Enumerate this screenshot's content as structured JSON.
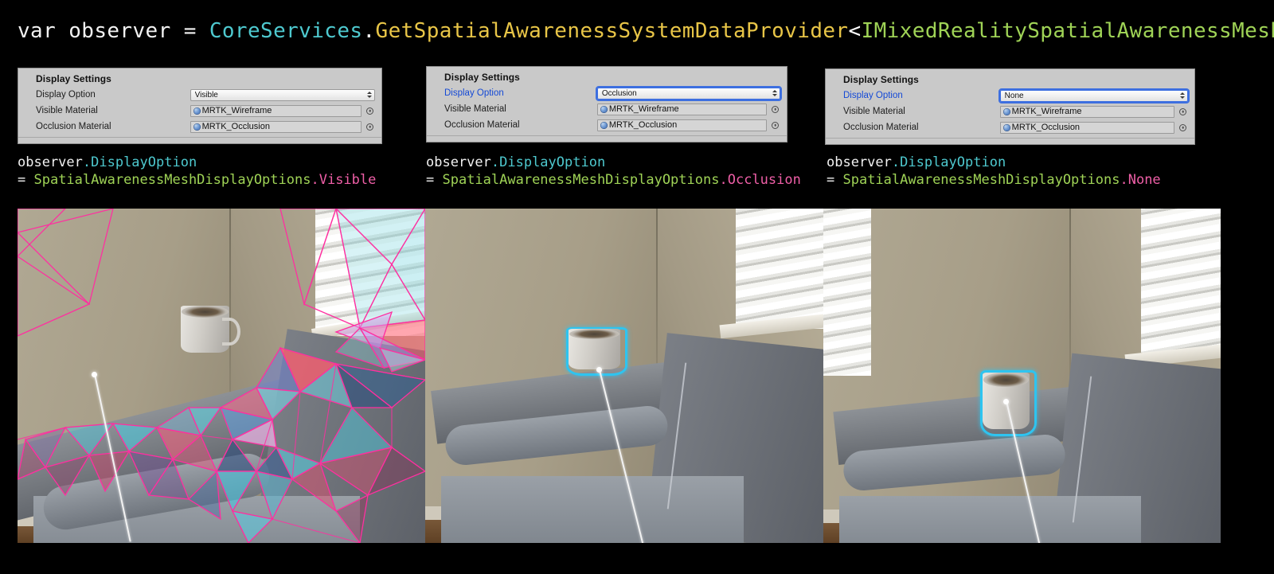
{
  "top_code": {
    "tokens": [
      {
        "t": "var observer = ",
        "c": "plain"
      },
      {
        "t": "CoreServices",
        "c": "cyan"
      },
      {
        "t": ".",
        "c": "white"
      },
      {
        "t": "GetSpatialAwarenessSystemDataProvider",
        "c": "yellow"
      },
      {
        "t": "<",
        "c": "white"
      },
      {
        "t": "IMixedRealitySpatialAwarenessMeshObserver",
        "c": "green"
      },
      {
        "t": ">();",
        "c": "white"
      }
    ],
    "full_text": "var observer = CoreServices.GetSpatialAwarenessSystemDataProvider<IMixedRealitySpatialAwarenessMeshObserver>();"
  },
  "panels": [
    {
      "id": "visible",
      "header": "Display Settings",
      "display_option": {
        "label": "Display Option",
        "value": "Visible",
        "label_modified": false,
        "focused": false
      },
      "visible_material": {
        "label": "Visible Material",
        "value": "MRTK_Wireframe"
      },
      "occlusion_material": {
        "label": "Occlusion Material",
        "value": "MRTK_Occlusion"
      }
    },
    {
      "id": "occlusion",
      "header": "Display Settings",
      "display_option": {
        "label": "Display Option",
        "value": "Occlusion",
        "label_modified": true,
        "focused": true
      },
      "visible_material": {
        "label": "Visible Material",
        "value": "MRTK_Wireframe"
      },
      "occlusion_material": {
        "label": "Occlusion Material",
        "value": "MRTK_Occlusion"
      }
    },
    {
      "id": "none",
      "header": "Display Settings",
      "display_option": {
        "label": "Display Option",
        "value": "None",
        "label_modified": true,
        "focused": true
      },
      "visible_material": {
        "label": "Visible Material",
        "value": "MRTK_Wireframe"
      },
      "occlusion_material": {
        "label": "Occlusion Material",
        "value": "MRTK_Occlusion"
      }
    }
  ],
  "code_blocks": [
    {
      "id": "visible",
      "line1_obj": "observer",
      "line1_prop": ".DisplayOption",
      "line2_eq": "= ",
      "line2_enum": "SpatialAwarenessMeshDisplayOptions",
      "line2_member": ".Visible",
      "full_text": "observer.DisplayOption = SpatialAwarenessMeshDisplayOptions.Visible"
    },
    {
      "id": "occlusion",
      "line1_obj": "observer",
      "line1_prop": ".DisplayOption",
      "line2_eq": "= ",
      "line2_enum": "SpatialAwarenessMeshDisplayOptions",
      "line2_member": ".Occlusion",
      "full_text": "observer.DisplayOption = SpatialAwarenessMeshDisplayOptions.Occlusion"
    },
    {
      "id": "none",
      "line1_obj": "observer",
      "line1_prop": ".DisplayOption",
      "line2_eq": "= ",
      "line2_enum": "SpatialAwarenessMeshDisplayOptions",
      "line2_member": ".None",
      "full_text": "observer.DisplayOption = SpatialAwarenessMeshDisplayOptions.None"
    }
  ],
  "photos": [
    {
      "id": "photo-visible",
      "caption": "AR view with spatial mesh wireframe rendered over couch and wall"
    },
    {
      "id": "photo-occlusion",
      "caption": "AR view with occlusion material, mug highlighted in cyan"
    },
    {
      "id": "photo-none",
      "caption": "AR view with mesh display off, mug highlighted in cyan"
    }
  ],
  "colors": {
    "background": "#000000",
    "code_plain": "#f2f2f2",
    "code_cyan": "#4ec9cf",
    "code_yellow": "#e8c547",
    "code_green": "#9fd356",
    "code_pink": "#ef5fa7",
    "panel_bg": "#c9c9c9",
    "label_modified": "#1449d6",
    "focus_ring": "#3d6fe0",
    "mesh_wireframe": "#ff2fa0",
    "highlight_outline": "#2ec4f0"
  },
  "icons": {
    "stepper": "stepper-updown-icon",
    "sphere": "material-sphere-icon",
    "target": "object-picker-target-icon"
  }
}
